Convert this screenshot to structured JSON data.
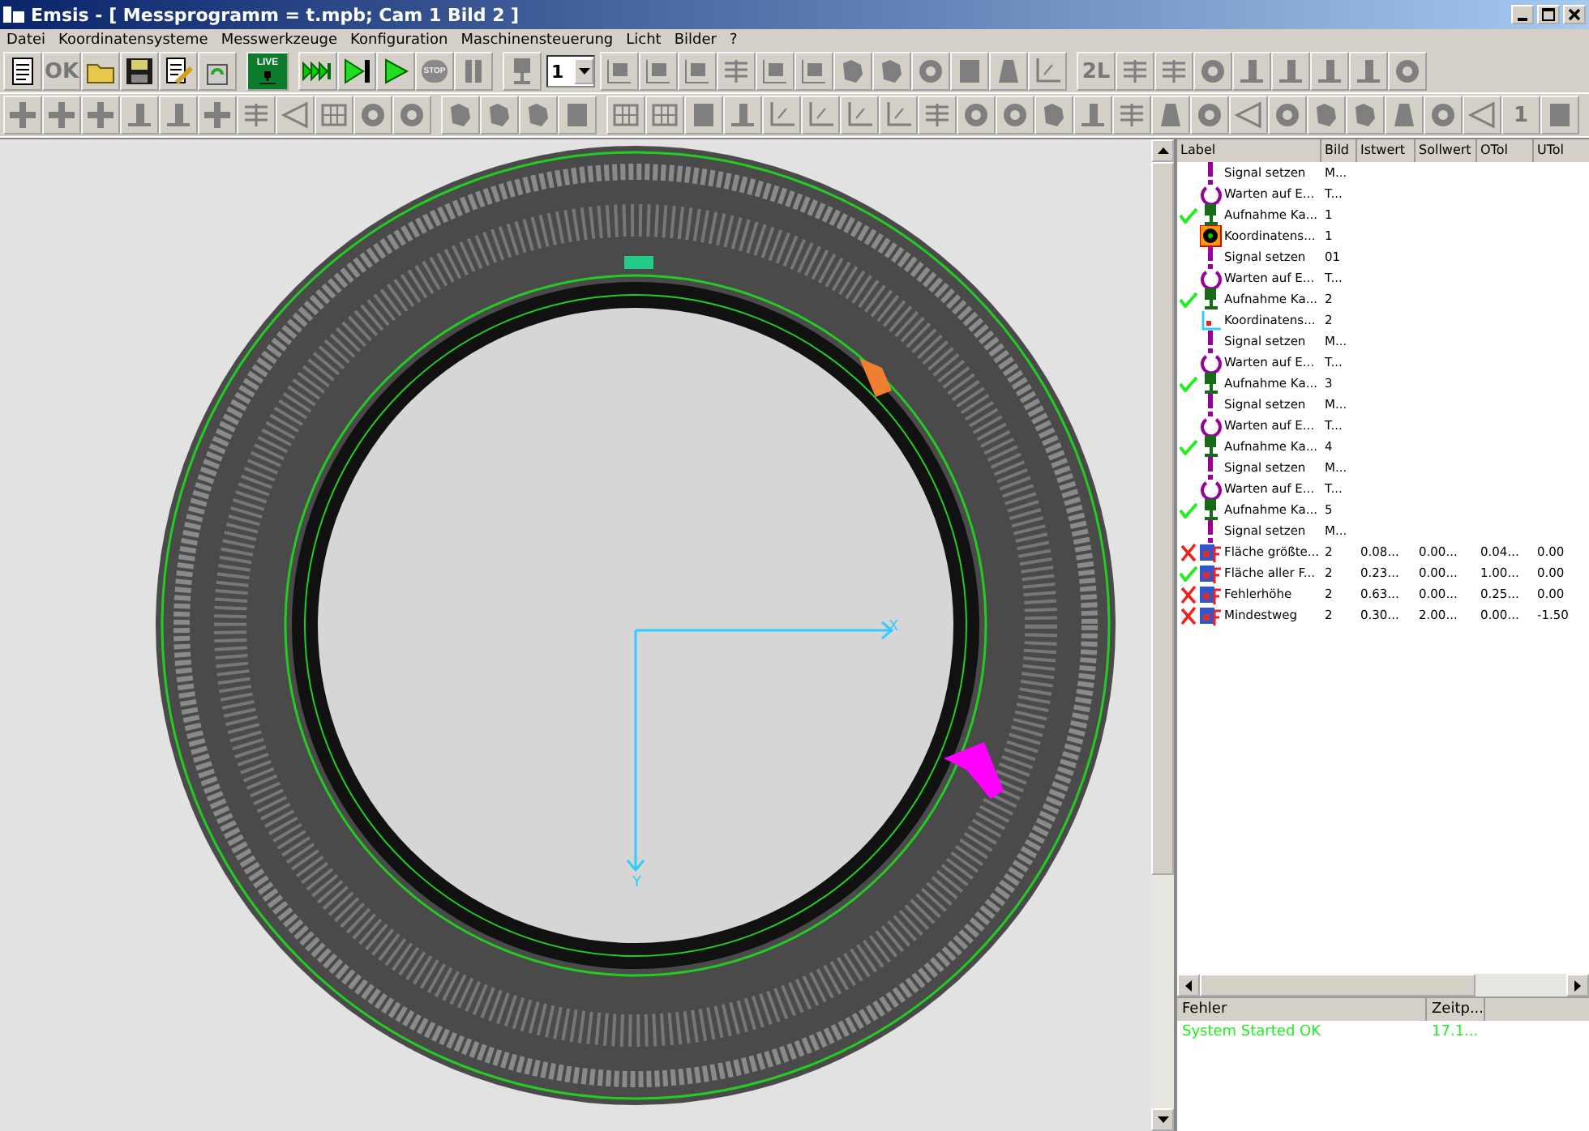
{
  "window": {
    "title": "Emsis - [ Messprogramm = t.mpb;  Cam 1 Bild 2 ]"
  },
  "menu": [
    "Datei",
    "Koordinatensysteme",
    "Messwerkzeuge",
    "Konfiguration",
    "Maschinensteuerung",
    "Licht",
    "Bilder",
    "?"
  ],
  "toolbar_1": [
    {
      "kind": "doc"
    },
    {
      "kind": "label",
      "label": "OK"
    },
    {
      "kind": "folder"
    },
    {
      "kind": "save"
    },
    {
      "kind": "edit"
    },
    {
      "kind": "recycle"
    },
    {
      "kind": "sep"
    },
    {
      "kind": "live",
      "label": "LIVE"
    },
    {
      "kind": "sep"
    },
    {
      "kind": "fastforward"
    },
    {
      "kind": "step"
    },
    {
      "kind": "play"
    },
    {
      "kind": "stop",
      "label": "STOP"
    },
    {
      "kind": "pause"
    },
    {
      "kind": "sep"
    },
    {
      "kind": "camera"
    },
    {
      "kind": "dropdown",
      "value": "1"
    },
    {
      "kind": "frame"
    },
    {
      "kind": "frame"
    },
    {
      "kind": "frame"
    },
    {
      "kind": "lines"
    },
    {
      "kind": "frame"
    },
    {
      "kind": "frame"
    },
    {
      "kind": "blob"
    },
    {
      "kind": "blob"
    },
    {
      "kind": "circle"
    },
    {
      "kind": "square"
    },
    {
      "kind": "trapezoid"
    },
    {
      "kind": "axes"
    },
    {
      "kind": "sep"
    },
    {
      "kind": "label",
      "label": "2L"
    },
    {
      "kind": "lines"
    },
    {
      "kind": "lines"
    },
    {
      "kind": "circle"
    },
    {
      "kind": "bar"
    },
    {
      "kind": "bar"
    },
    {
      "kind": "bar"
    },
    {
      "kind": "bar"
    },
    {
      "kind": "circle"
    }
  ],
  "toolbar_2": [
    {
      "kind": "cross"
    },
    {
      "kind": "cross"
    },
    {
      "kind": "cross"
    },
    {
      "kind": "bar"
    },
    {
      "kind": "bar"
    },
    {
      "kind": "cross"
    },
    {
      "kind": "lines"
    },
    {
      "kind": "triangle"
    },
    {
      "kind": "grid"
    },
    {
      "kind": "circle"
    },
    {
      "kind": "circle"
    },
    {
      "kind": "sep"
    },
    {
      "kind": "blob"
    },
    {
      "kind": "blob"
    },
    {
      "kind": "blob"
    },
    {
      "kind": "square"
    },
    {
      "kind": "sep"
    },
    {
      "kind": "grid"
    },
    {
      "kind": "grid"
    },
    {
      "kind": "square"
    },
    {
      "kind": "bar"
    },
    {
      "kind": "axes"
    },
    {
      "kind": "axes"
    },
    {
      "kind": "axes"
    },
    {
      "kind": "axes"
    },
    {
      "kind": "lines"
    },
    {
      "kind": "circle"
    },
    {
      "kind": "circle"
    },
    {
      "kind": "blob"
    },
    {
      "kind": "bar"
    },
    {
      "kind": "lines"
    },
    {
      "kind": "trapezoid"
    },
    {
      "kind": "circle"
    },
    {
      "kind": "triangle"
    },
    {
      "kind": "circle"
    },
    {
      "kind": "blob"
    },
    {
      "kind": "blob"
    },
    {
      "kind": "trapezoid"
    },
    {
      "kind": "circle"
    },
    {
      "kind": "triangle"
    },
    {
      "kind": "label",
      "label": "1"
    },
    {
      "kind": "square"
    }
  ],
  "image_view": {
    "x_axis_label": "X",
    "y_axis_label": "Y"
  },
  "program_table": {
    "columns": [
      "Label",
      "Bild",
      "Istwert",
      "Sollwert",
      "OTol",
      "UTol"
    ],
    "rows": [
      {
        "kind": "signal",
        "cells": [
          "Signal setzen",
          "M..."
        ]
      },
      {
        "kind": "wait",
        "cells": [
          "Warten auf E...",
          "T..."
        ]
      },
      {
        "passed": true,
        "kind": "camera",
        "cells": [
          "Aufnahme Ka...",
          "1"
        ]
      },
      {
        "kind": "coord_target",
        "cells": [
          "Koordinatens...",
          "1"
        ]
      },
      {
        "kind": "signal",
        "cells": [
          "Signal setzen",
          "01"
        ]
      },
      {
        "kind": "wait",
        "cells": [
          "Warten auf E...",
          "T..."
        ]
      },
      {
        "passed": true,
        "kind": "camera",
        "cells": [
          "Aufnahme Ka...",
          "2"
        ]
      },
      {
        "kind": "coord_axes",
        "cells": [
          "Koordinatens...",
          "2"
        ]
      },
      {
        "kind": "signal",
        "cells": [
          "Signal setzen",
          "M..."
        ]
      },
      {
        "kind": "wait",
        "cells": [
          "Warten auf E...",
          "T..."
        ]
      },
      {
        "passed": true,
        "kind": "camera",
        "cells": [
          "Aufnahme Ka...",
          "3"
        ]
      },
      {
        "kind": "signal",
        "cells": [
          "Signal setzen",
          "M..."
        ]
      },
      {
        "kind": "wait",
        "cells": [
          "Warten auf E...",
          "T..."
        ]
      },
      {
        "passed": true,
        "kind": "camera",
        "cells": [
          "Aufnahme Ka...",
          "4"
        ]
      },
      {
        "kind": "signal",
        "cells": [
          "Signal setzen",
          "M..."
        ]
      },
      {
        "kind": "wait",
        "cells": [
          "Warten auf E...",
          "T..."
        ]
      },
      {
        "passed": true,
        "kind": "camera",
        "cells": [
          "Aufnahme Ka...",
          "5"
        ]
      },
      {
        "kind": "signal",
        "cells": [
          "Signal setzen",
          "M..."
        ]
      },
      {
        "passed": false,
        "kind": "feature",
        "cells": [
          "Fläche größte...",
          "2",
          "0.08...",
          "0.00...",
          "0.04...",
          "0.00"
        ]
      },
      {
        "passed": true,
        "kind": "feature",
        "cells": [
          "Fläche aller F...",
          "2",
          "0.23...",
          "0.00...",
          "1.00...",
          "0.00"
        ]
      },
      {
        "passed": false,
        "kind": "feature",
        "cells": [
          "Fehlerhöhe",
          "2",
          "0.63...",
          "0.00...",
          "0.25...",
          "0.00"
        ]
      },
      {
        "passed": false,
        "kind": "feature",
        "cells": [
          "Mindestweg",
          "2",
          "0.30...",
          "2.00...",
          "0.00...",
          "-1.50"
        ]
      }
    ]
  },
  "error_log": {
    "columns": [
      "Fehler",
      "Zeitp..."
    ],
    "rows": [
      {
        "cells": [
          "System Started OK",
          "17.1..."
        ]
      }
    ]
  }
}
